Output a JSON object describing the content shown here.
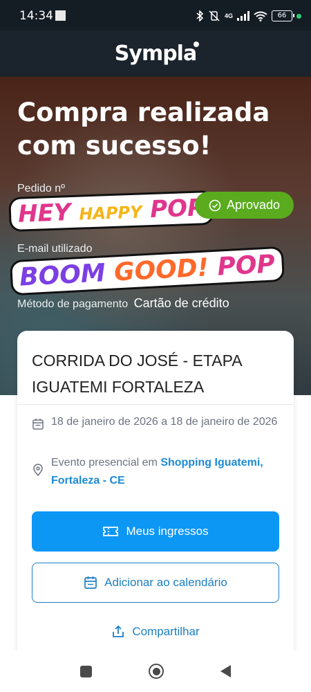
{
  "status_bar": {
    "time": "14:34",
    "network": "4G",
    "battery": "66"
  },
  "header": {
    "brand": "Sympla"
  },
  "hero": {
    "title": "Compra realizada com sucesso!",
    "order_label": "Pedido nº",
    "order_sticker_words": [
      "HEY",
      "HAPPY",
      "POP"
    ],
    "status_badge": "Aprovado",
    "email_label": "E-mail utilizado",
    "email_sticker_words": [
      "BOOM",
      "GOOD!",
      "POP"
    ],
    "payment_label": "Método de pagamento",
    "payment_value": "Cartão de crédito"
  },
  "event": {
    "title": "CORRIDA DO JOSÉ - ETAPA IGUATEMI FORTALEZA",
    "date": "18 de janeiro de 2026 a 18 de janeiro de 2026",
    "location_prefix": "Evento presencial em",
    "location_link": "Shopping Iguatemi, Fortaleza - CE"
  },
  "actions": {
    "tickets": "Meus ingressos",
    "calendar": "Adicionar ao calendário",
    "share": "Compartilhar"
  },
  "colors": {
    "primary": "#0d97f5",
    "approved": "#5aab1e",
    "link": "#1c8ad6"
  }
}
